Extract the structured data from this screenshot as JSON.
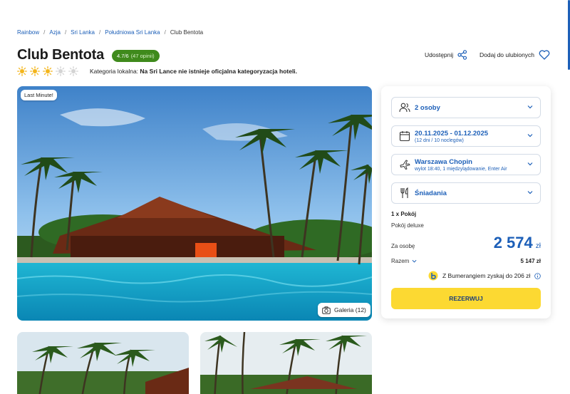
{
  "breadcrumb": {
    "items": [
      "Rainbow",
      "Azja",
      "Sri Lanka",
      "Południowa Sri Lanka"
    ],
    "separator": "/",
    "current": "Club Bentota"
  },
  "hotel": {
    "name": "Club Bentota",
    "rating": "4.7/6",
    "reviews": "(47 opinii)",
    "stars_total": 5,
    "stars_filled": 3,
    "category_label": "Kategoria lokalna:",
    "category_text": "Na Sri Lance nie istnieje oficjalna kategoryzacja hoteli."
  },
  "actions": {
    "share_label": "Udostępnij",
    "favorite_label": "Dodaj do ulubionych"
  },
  "photo": {
    "badge": "Last Minute!",
    "gallery_label": "Galeria (12)"
  },
  "booking": {
    "persons": "2 osoby",
    "dates": "20.11.2025 - 01.12.2025",
    "dates_sub": "(12 dni / 10 noclegów)",
    "flight": "Warszawa Chopin",
    "flight_sub": "wylot 18:40, 1 międzylądowanie, Enter Air",
    "board": "Śniadania",
    "room_count": "1 x Pokój",
    "room_name": "Pokój deluxe",
    "per_person_label": "Za osobę",
    "per_person_price": "2 574",
    "currency": "zł",
    "total_label": "Razem",
    "total_value": "5 147 zł",
    "bumerang_text": "Z Bumerangiem zyskaj do 206 zł",
    "book_button": "REZERWUJ"
  },
  "colors": {
    "accent_blue": "#1c5fb8",
    "rating_green": "#3f8a1c",
    "button_yellow": "#fcd932",
    "star_sun": "#f3b51c"
  }
}
